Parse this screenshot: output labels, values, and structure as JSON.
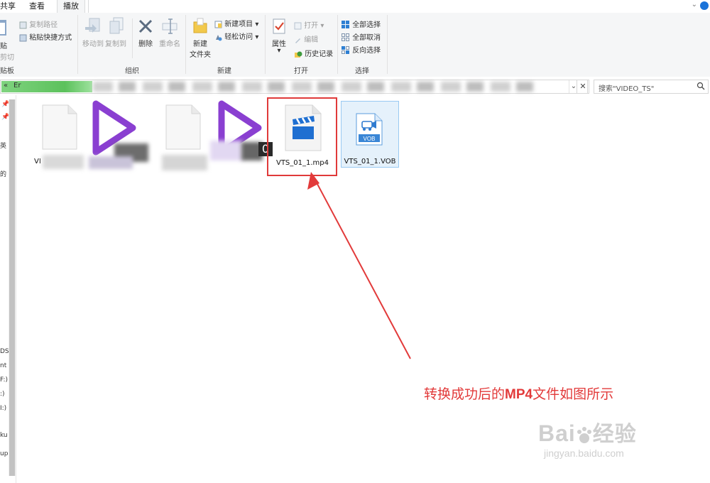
{
  "tabs": {
    "share": "共享",
    "view": "查看",
    "play": "播放"
  },
  "ribbon": {
    "clipboard": {
      "paste": "贴",
      "copy_path": "复制路径",
      "paste_shortcut": "粘贴快捷方式",
      "cut": "剪切",
      "label": "贴板"
    },
    "organize": {
      "move_to": "移动到",
      "copy_to": "复制到",
      "delete": "删除",
      "rename": "重命名",
      "label": "组织"
    },
    "new": {
      "new_folder_line1": "新建",
      "new_folder_line2": "文件夹",
      "new_item": "新建项目",
      "easy_access": "轻松访问",
      "label": "新建"
    },
    "open": {
      "properties": "属性",
      "open": "打开",
      "edit": "编辑",
      "history": "历史记录",
      "label": "打开"
    },
    "select": {
      "select_all": "全部选择",
      "select_none": "全部取消",
      "invert": "反向选择",
      "label": "选择"
    }
  },
  "address": {
    "back_chevron": "«",
    "path_start": "Er"
  },
  "search": {
    "placeholder": "搜索\"VIDEO_TS\""
  },
  "nav": {
    "items": [
      "英",
      "的",
      "DS",
      "nt",
      "F:)",
      ":)",
      "I:)",
      "ku",
      "up"
    ]
  },
  "files": [
    {
      "name": "VI",
      "icon": "blank-file-icon",
      "blurred": true
    },
    {
      "name": "",
      "icon": "play-logo-icon",
      "blurred": true
    },
    {
      "name": "",
      "icon": "blank-file-icon",
      "blurred": true
    },
    {
      "name": "0",
      "icon": "play-logo-icon",
      "blurred": true
    },
    {
      "name": "VTS_01_1.mp4",
      "icon": "video-clapper-icon",
      "blurred": false
    },
    {
      "name": "VTS_01_1.VOB",
      "icon": "vob-file-icon",
      "blurred": false
    }
  ],
  "annotation": {
    "text_before": "转换成功后的",
    "text_bold": "MP4",
    "text_after": "文件如图所示",
    "color": "#e23a3a"
  },
  "watermark": {
    "brand": "Bai",
    "brand_after": "经验",
    "url": "jingyan.baidu.com"
  },
  "colors": {
    "ribbon_bg": "#f5f6f7",
    "accent_blue": "#1a73d9",
    "play_purple": "#8a3fd1",
    "highlight_red": "#e03a3a",
    "progress_green": "#5cc15c"
  }
}
